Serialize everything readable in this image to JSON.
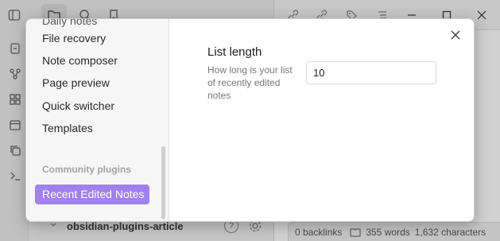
{
  "background": {
    "vault_name": "obsidian-plugins-article",
    "vault_help_glyph": "?",
    "status": {
      "backlinks": "0 backlinks",
      "words": "355 words",
      "characters": "1,632 characters"
    }
  },
  "modal": {
    "sidebar": {
      "cut_item": "Daily notes",
      "items": [
        {
          "label": "File recovery"
        },
        {
          "label": "Note composer"
        },
        {
          "label": "Page preview"
        },
        {
          "label": "Quick switcher"
        },
        {
          "label": "Templates"
        }
      ],
      "community_heading": "Community plugins",
      "selected_item": "Recent Edited Notes"
    },
    "setting": {
      "name": "List length",
      "description": "How long is your list of recently edited notes",
      "value": "10"
    }
  },
  "colors": {
    "accent": "#a181f0"
  }
}
